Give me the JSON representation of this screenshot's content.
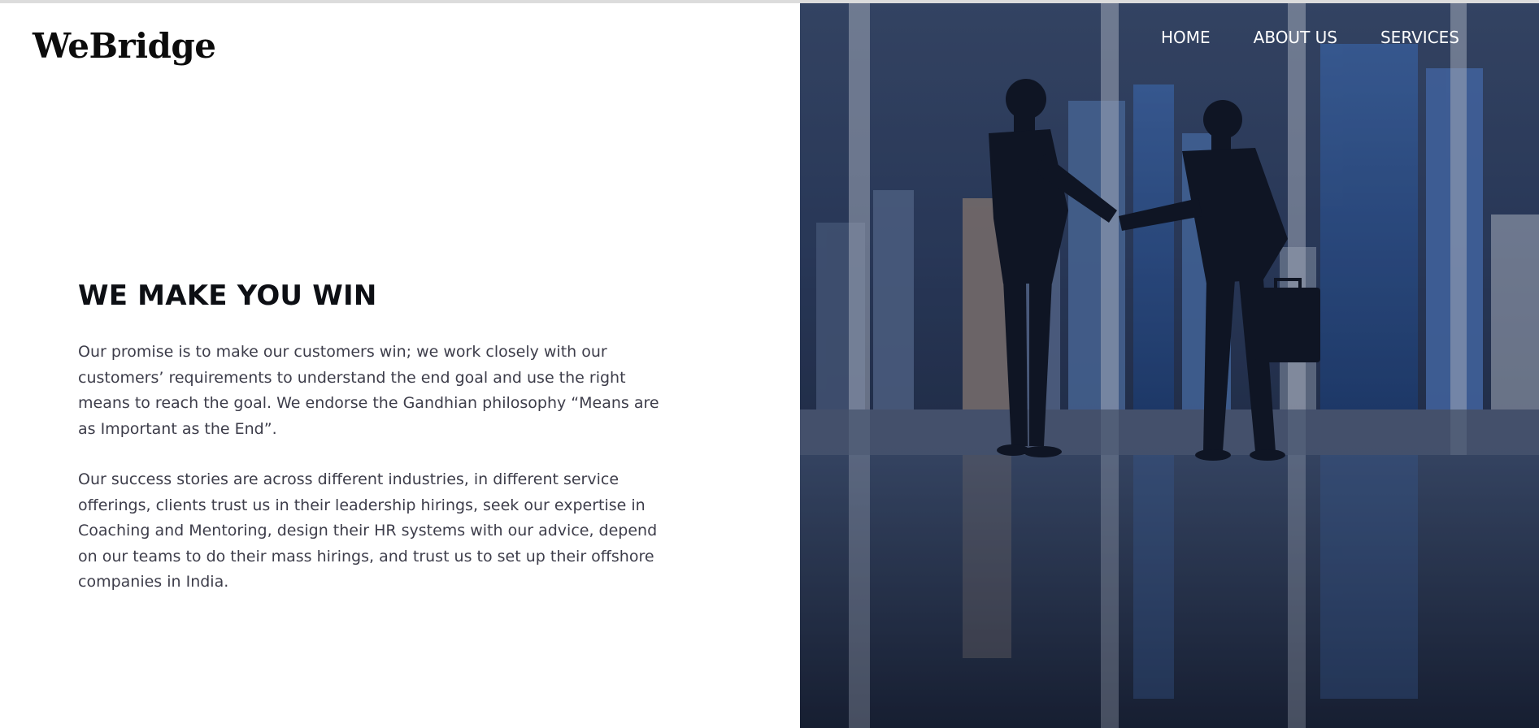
{
  "brand": {
    "name": "WeBridge"
  },
  "nav": {
    "items": [
      {
        "label": "HOME"
      },
      {
        "label": "ABOUT US"
      },
      {
        "label": "SERVICES"
      }
    ]
  },
  "hero": {
    "title": "WE MAKE YOU WIN",
    "paragraphs": [
      "Our promise is to make our customers win; we work closely with our customers’ requirements to understand the end goal and use the right means to reach the goal. We endorse the Gandhian philosophy “Means are as Important as the End”.",
      "Our success stories are across different industries, in different service offerings, clients trust us in their leadership hirings, seek our expertise in Coaching and Mentoring, design their HR systems with our advice, depend on our teams to do their mass hirings, and trust us to set up their offshore companies in India."
    ]
  },
  "image": {
    "subject": "business-handshake-photo"
  },
  "colors": {
    "text_dark": "#0d0f14",
    "text_body": "#3d3d4a",
    "photo_tint": "#24324f",
    "nav_text": "#ffffff"
  }
}
